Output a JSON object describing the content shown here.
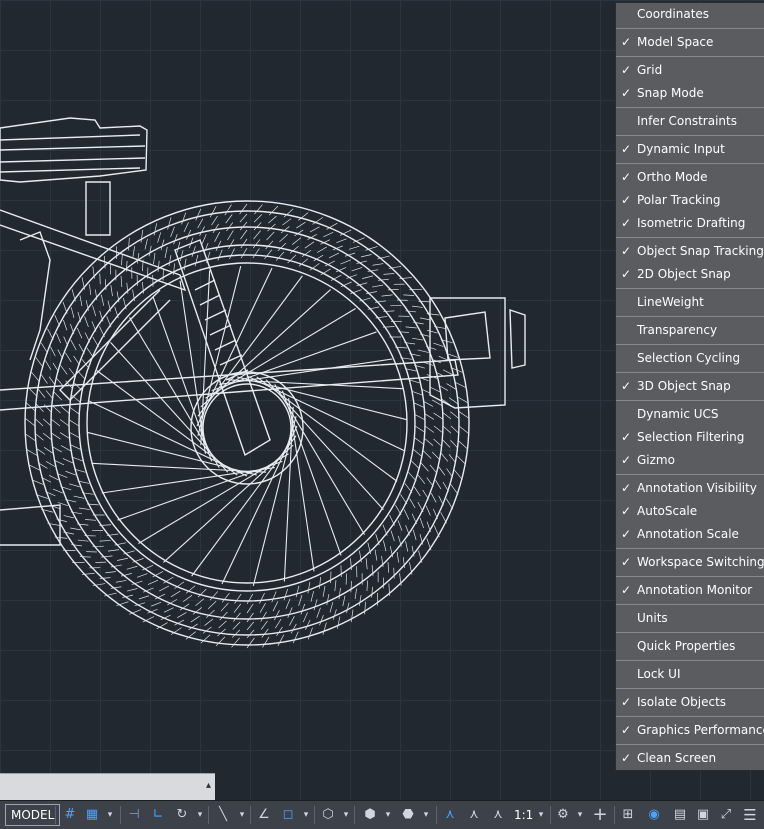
{
  "context_menu": {
    "groups": [
      [
        {
          "label": "Coordinates",
          "checked": false
        }
      ],
      [
        {
          "label": "Model Space",
          "checked": true
        }
      ],
      [
        {
          "label": "Grid",
          "checked": true
        },
        {
          "label": "Snap Mode",
          "checked": true
        }
      ],
      [
        {
          "label": "Infer Constraints",
          "checked": false
        }
      ],
      [
        {
          "label": "Dynamic Input",
          "checked": true
        }
      ],
      [
        {
          "label": "Ortho Mode",
          "checked": true
        },
        {
          "label": "Polar Tracking",
          "checked": true
        },
        {
          "label": "Isometric Drafting",
          "checked": true
        }
      ],
      [
        {
          "label": "Object Snap Tracking",
          "checked": true
        },
        {
          "label": "2D Object Snap",
          "checked": true
        }
      ],
      [
        {
          "label": "LineWeight",
          "checked": false
        }
      ],
      [
        {
          "label": "Transparency",
          "checked": false
        }
      ],
      [
        {
          "label": "Selection Cycling",
          "checked": false
        }
      ],
      [
        {
          "label": "3D Object Snap",
          "checked": true
        }
      ],
      [
        {
          "label": "Dynamic UCS",
          "checked": false
        },
        {
          "label": "Selection Filtering",
          "checked": true
        },
        {
          "label": "Gizmo",
          "checked": true
        }
      ],
      [
        {
          "label": "Annotation Visibility",
          "checked": true
        },
        {
          "label": "AutoScale",
          "checked": true
        },
        {
          "label": "Annotation Scale",
          "checked": true
        }
      ],
      [
        {
          "label": "Workspace Switching",
          "checked": true
        }
      ],
      [
        {
          "label": "Annotation Monitor",
          "checked": true
        }
      ],
      [
        {
          "label": "Units",
          "checked": false
        }
      ],
      [
        {
          "label": "Quick Properties",
          "checked": false
        }
      ],
      [
        {
          "label": "Lock UI",
          "checked": false
        }
      ],
      [
        {
          "label": "Isolate Objects",
          "checked": true
        }
      ],
      [
        {
          "label": "Graphics Performance",
          "checked": true
        }
      ],
      [
        {
          "label": "Clean Screen",
          "checked": true
        }
      ]
    ]
  },
  "statusbar": {
    "model_label": "MODEL",
    "annotation_scale": "1:1"
  },
  "colors": {
    "canvas_bg": "#212830",
    "menu_bg": "#5b5c60",
    "statusbar_bg": "#3c414a",
    "active_blue": "#4aa3ff"
  },
  "icons": {
    "check": "✓",
    "dropdown": "▾",
    "collapse": "▴"
  }
}
